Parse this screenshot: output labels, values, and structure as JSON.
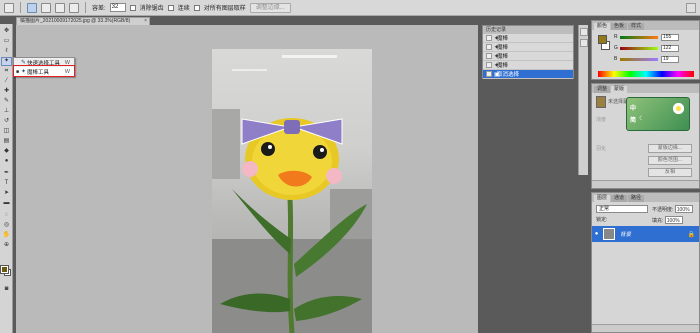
{
  "options_bar": {
    "feather_label": "容差:",
    "feather_value": "32",
    "antialias_label": "消除锯齿",
    "contiguous_label": "连续",
    "all_layers_label": "对所有图层取样",
    "refine_edge_label": "调整边缘..."
  },
  "document": {
    "tab_title": "橘猫图片_20210009172025.jpg @ 33.3%(RGB/8)",
    "close_glyph": "×"
  },
  "tool_flyout": {
    "items": [
      {
        "icon": "quick-selection-icon",
        "glyph": "✎",
        "label": "快速选择工具",
        "shortcut": "W"
      },
      {
        "icon": "magic-wand-icon",
        "glyph": "✦",
        "label": "魔棒工具",
        "shortcut": "W"
      }
    ]
  },
  "history_panel": {
    "title": "历史记录",
    "items": [
      {
        "label": "魔棒",
        "selected": false
      },
      {
        "label": "魔棒",
        "selected": false
      },
      {
        "label": "魔棒",
        "selected": false
      },
      {
        "label": "魔棒",
        "selected": false
      },
      {
        "label": "取消选择",
        "selected": true
      }
    ]
  },
  "color_panel": {
    "tabs": [
      "颜色",
      "色板",
      "样式"
    ],
    "r": "155",
    "g": "122",
    "b": "19",
    "r_label": "R",
    "g_label": "G",
    "b_label": "B",
    "fg_color": "#9b7a13"
  },
  "style_panel": {
    "tabs": [
      "调整",
      "蒙版"
    ],
    "name": "未选择蒙版",
    "sticker_line1": "中",
    "sticker_line2": "简",
    "label_density": "浓度",
    "label_feather": "羽化",
    "buttons": [
      "蒙版边缘...",
      "颜色范围...",
      "反相"
    ]
  },
  "layers_panel": {
    "tabs": [
      "图层",
      "通道",
      "路径"
    ],
    "blend_mode": "正常",
    "opacity_label": "不透明度:",
    "opacity_value": "100%",
    "lock_label": "锁定:",
    "fill_label": "填充:",
    "fill_value": "100%",
    "layer_name": "背景",
    "eye_glyph": "●",
    "lock_glyph": "🔒"
  },
  "colors": {
    "selection_blue": "#2f6fd1",
    "highlight_red": "#e02020",
    "canvas_gray": "#bababa"
  }
}
